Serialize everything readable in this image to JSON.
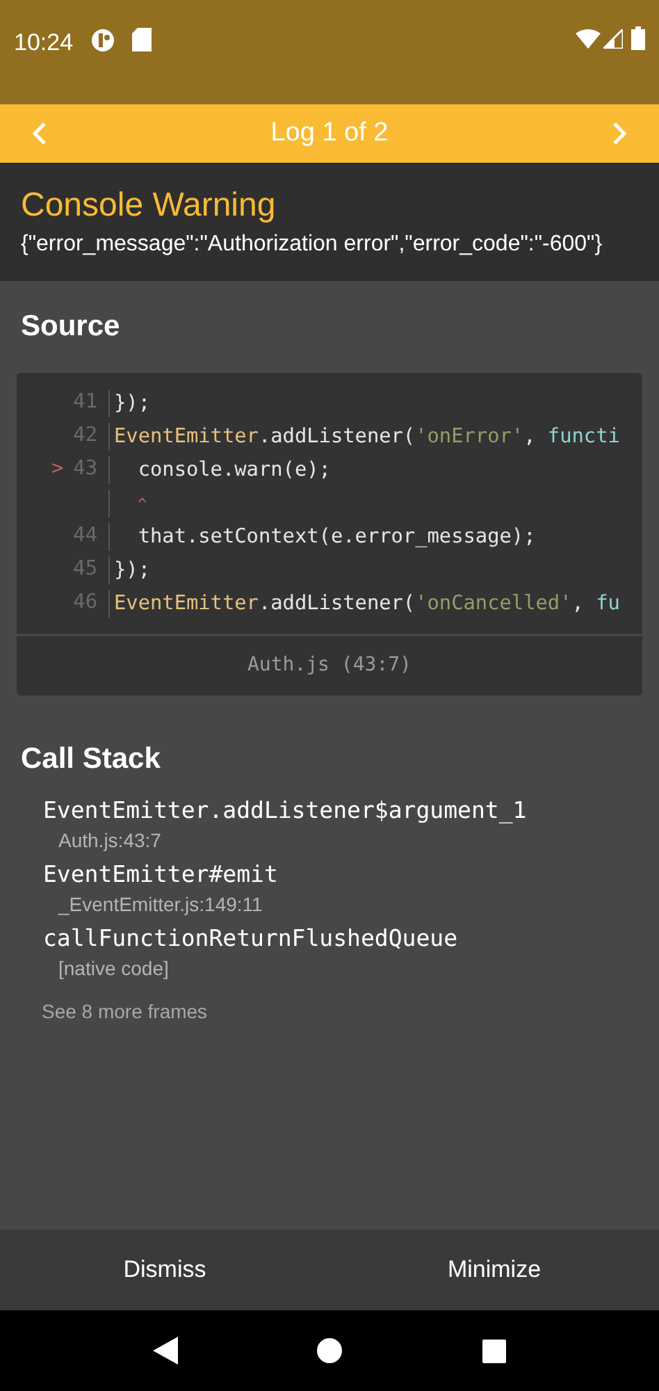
{
  "status_bar": {
    "time": "10:24"
  },
  "nav": {
    "title": "Log 1 of 2"
  },
  "header": {
    "title": "Console Warning",
    "message": "{\"error_message\":\"Authorization error\",\"error_code\":\"-600\"}"
  },
  "source": {
    "title": "Source",
    "lines": [
      {
        "kind": "code",
        "number": "41",
        "tokens": [
          {
            "kind": "plain",
            "text": "});"
          }
        ]
      },
      {
        "kind": "code",
        "number": "42",
        "tokens": [
          {
            "kind": "ident",
            "text": "EventEmitter"
          },
          {
            "kind": "plain",
            "text": ".addListener("
          },
          {
            "kind": "string",
            "text": "'onError'"
          },
          {
            "kind": "plain",
            "text": ", "
          },
          {
            "kind": "keyword",
            "text": "functi"
          }
        ]
      },
      {
        "kind": "code",
        "number": "43",
        "marker": ">",
        "tokens": [
          {
            "kind": "plain",
            "text": "  console.warn(e);"
          }
        ]
      },
      {
        "kind": "caret",
        "text": "^"
      },
      {
        "kind": "code",
        "number": "44",
        "tokens": [
          {
            "kind": "plain",
            "text": "  that.setContext(e.error_message);"
          }
        ]
      },
      {
        "kind": "code",
        "number": "45",
        "tokens": [
          {
            "kind": "plain",
            "text": "});"
          }
        ]
      },
      {
        "kind": "code",
        "number": "46",
        "tokens": [
          {
            "kind": "ident",
            "text": "EventEmitter"
          },
          {
            "kind": "plain",
            "text": ".addListener("
          },
          {
            "kind": "string",
            "text": "'onCancelled'"
          },
          {
            "kind": "plain",
            "text": ", "
          },
          {
            "kind": "keyword",
            "text": "fu"
          }
        ]
      }
    ],
    "file": "Auth.js (43:7)"
  },
  "call_stack": {
    "title": "Call Stack",
    "frames": [
      {
        "name": "EventEmitter.addListener$argument_1",
        "location": "Auth.js:43:7"
      },
      {
        "name": "EventEmitter#emit",
        "location": "_EventEmitter.js:149:11"
      },
      {
        "name": "callFunctionReturnFlushedQueue",
        "location": "[native code]"
      }
    ],
    "more": "See 8 more frames"
  },
  "footer": {
    "buttons": [
      "Dismiss",
      "Minimize"
    ]
  }
}
